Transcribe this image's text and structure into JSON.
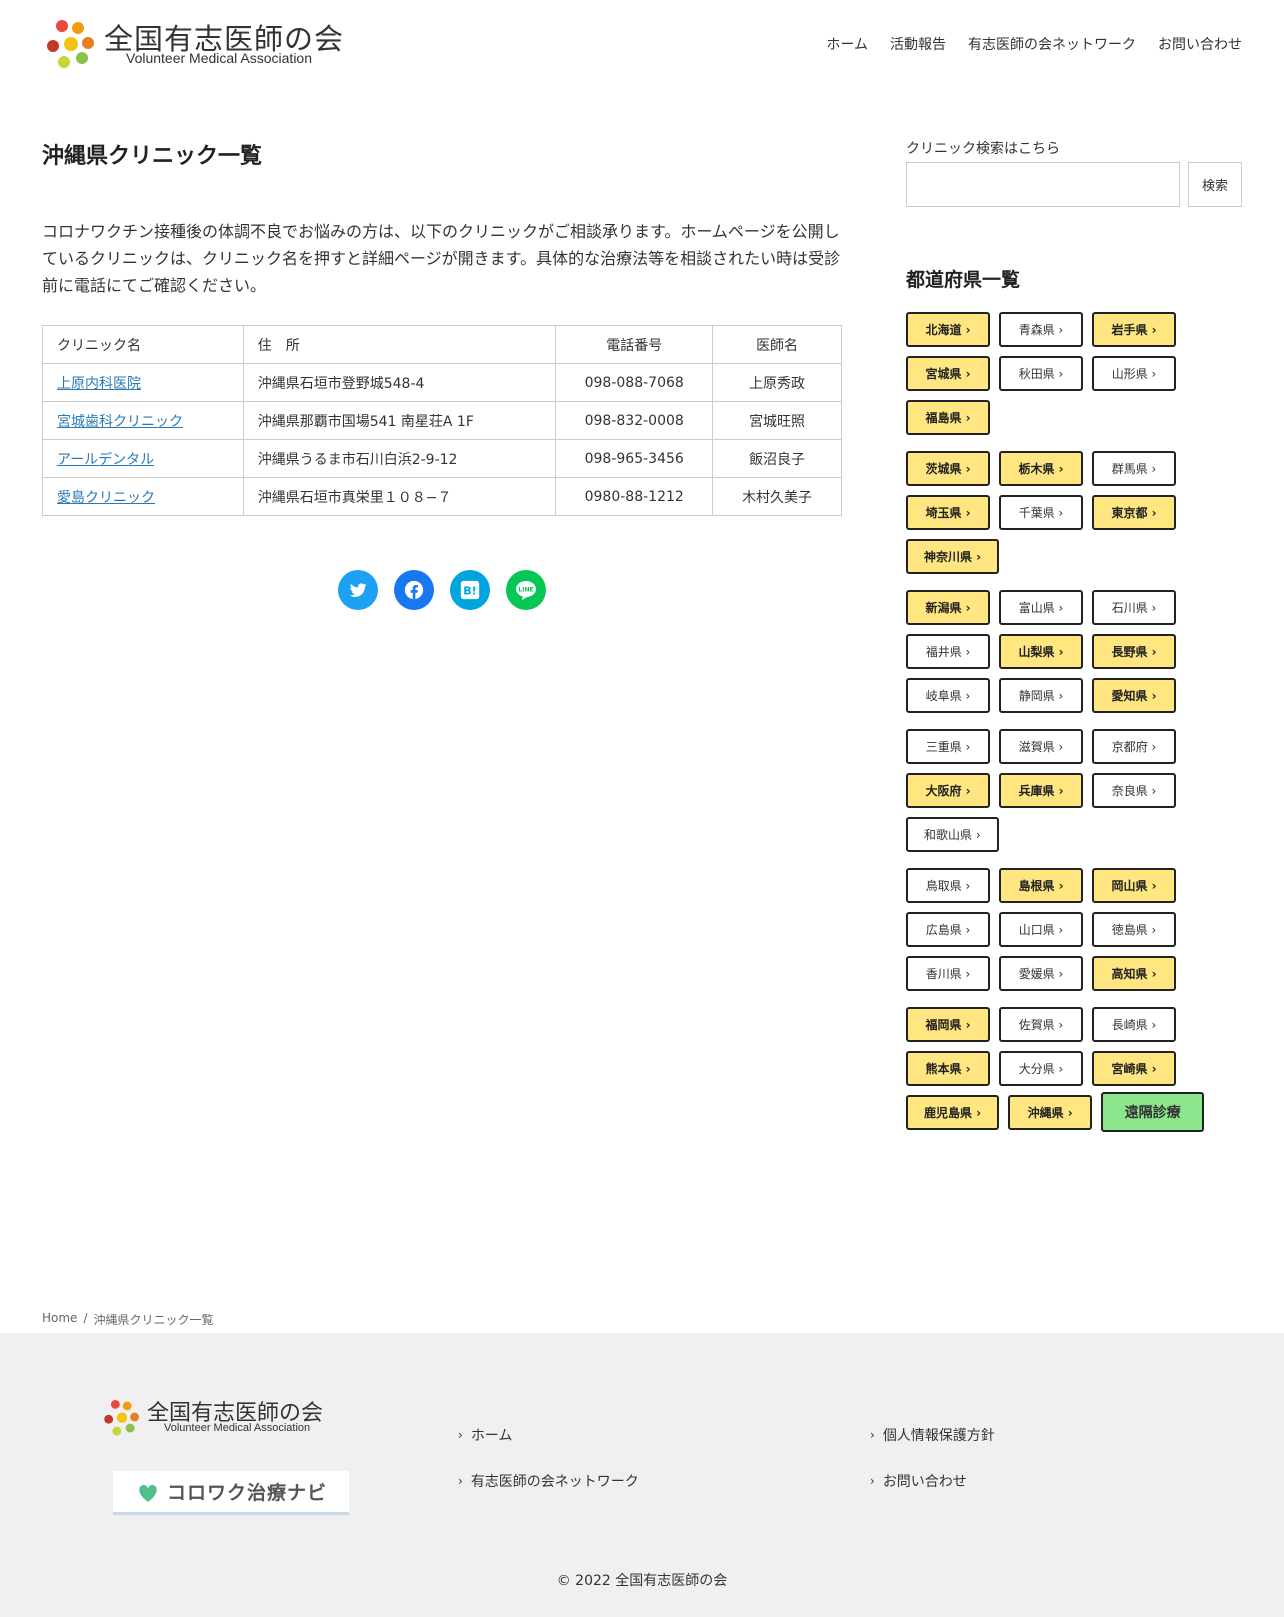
{
  "brand": {
    "name_ja": "全国有志医師の会",
    "name_en": "Volunteer Medical Association"
  },
  "nav": [
    "ホーム",
    "活動報告",
    "有志医師の会ネットワーク",
    "お問い合わせ"
  ],
  "main": {
    "title": "沖縄県クリニック一覧",
    "intro": "コロナワクチン接種後の体調不良でお悩みの方は、以下のクリニックがご相談承ります。ホームページを公開しているクリニックは、クリニック名を押すと詳細ページが開きます。具体的な治療法等を相談されたい時は受診前に電話にてご確認ください。",
    "table": {
      "headers": [
        "クリニック名",
        "住　所",
        "電話番号",
        "医師名"
      ],
      "rows": [
        [
          "上原内科医院",
          "沖縄県石垣市登野城548-4",
          "098-088-7068",
          "上原秀政"
        ],
        [
          "宮城歯科クリニック",
          "沖縄県那覇市国場541 南星荘A 1F",
          "098-832-0008",
          "宮城旺照"
        ],
        [
          "アールデンタル",
          "沖縄県うるま市石川白浜2-9-12",
          "098-965-3456",
          "飯沼良子"
        ],
        [
          "愛島クリニック",
          "沖縄県石垣市真栄里１０８−７",
          "0980-88-1212",
          "木村久美子"
        ]
      ]
    }
  },
  "share": [
    "twitter-icon",
    "facebook-icon",
    "hatena-icon",
    "line-icon"
  ],
  "sidebar": {
    "search_label": "クリニック検索はこちら",
    "search_button": "検索",
    "search_value": "",
    "pref_title": "都道府県一覧",
    "groups": [
      [
        [
          "北海道 ›",
          true
        ],
        [
          "青森県 ›",
          false
        ],
        [
          "岩手県 ›",
          true
        ],
        [
          "宮城県 ›",
          true
        ],
        [
          "秋田県 ›",
          false
        ],
        [
          "山形県 ›",
          false
        ],
        [
          "福島県 ›",
          true
        ]
      ],
      [
        [
          "茨城県 ›",
          true
        ],
        [
          "栃木県 ›",
          true
        ],
        [
          "群馬県 ›",
          false
        ],
        [
          "埼玉県 ›",
          true
        ],
        [
          "千葉県 ›",
          false
        ],
        [
          "東京都 ›",
          true
        ],
        [
          "神奈川県 ›",
          true
        ]
      ],
      [
        [
          "新潟県 ›",
          true
        ],
        [
          "富山県 ›",
          false
        ],
        [
          "石川県 ›",
          false
        ],
        [
          "福井県 ›",
          false
        ],
        [
          "山梨県 ›",
          true
        ],
        [
          "長野県 ›",
          true
        ],
        [
          "岐阜県 ›",
          false
        ],
        [
          "静岡県 ›",
          false
        ],
        [
          "愛知県 ›",
          true
        ]
      ],
      [
        [
          "三重県 ›",
          false
        ],
        [
          "滋賀県 ›",
          false
        ],
        [
          "京都府 ›",
          false
        ],
        [
          "大阪府 ›",
          true
        ],
        [
          "兵庫県 ›",
          true
        ],
        [
          "奈良県 ›",
          false
        ],
        [
          "和歌山県 ›",
          false
        ]
      ],
      [
        [
          "鳥取県 ›",
          false
        ],
        [
          "島根県 ›",
          true
        ],
        [
          "岡山県 ›",
          true
        ],
        [
          "広島県 ›",
          false
        ],
        [
          "山口県 ›",
          false
        ],
        [
          "徳島県 ›",
          false
        ],
        [
          "香川県 ›",
          false
        ],
        [
          "愛媛県 ›",
          false
        ],
        [
          "高知県 ›",
          true
        ]
      ],
      [
        [
          "福岡県 ›",
          true
        ],
        [
          "佐賀県 ›",
          false
        ],
        [
          "長崎県 ›",
          false
        ],
        [
          "熊本県 ›",
          true
        ],
        [
          "大分県 ›",
          false
        ],
        [
          "宮崎県 ›",
          true
        ],
        [
          "鹿児島県 ›",
          true
        ],
        [
          "沖縄県 ›",
          true
        ]
      ]
    ],
    "remote_label": "遠隔診療"
  },
  "breadcrumb": {
    "home": "Home",
    "sep": "/",
    "current": "沖縄県クリニック一覧"
  },
  "footer": {
    "links_left": [
      "ホーム",
      "有志医師の会ネットワーク"
    ],
    "links_right": [
      "個人情報保護方針",
      "お問い合わせ"
    ],
    "banner_text": "コロワク治療ナビ",
    "copyright": "© 2022 全国有志医師の会"
  },
  "colors": {
    "highlight": "#ffe680",
    "remote": "#8de68d",
    "link": "#2a7ab8",
    "footer_bg": "#f0f0f2"
  }
}
